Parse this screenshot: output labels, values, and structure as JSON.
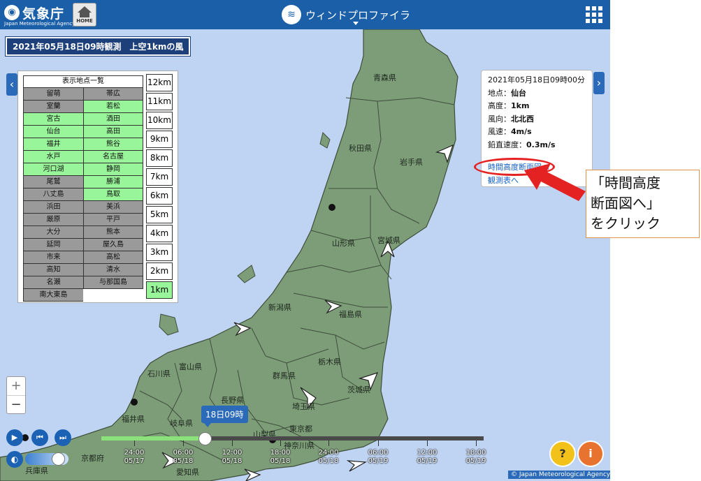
{
  "header": {
    "logo_jp": "気象庁",
    "logo_en": "Japan Meteorological Agency",
    "home_label": "HOME",
    "title": "ウィンドプロファイラ"
  },
  "observation_label": "2021年05月18日09時観測　上空1kmの風",
  "stations": {
    "heading": "表示地点一覧",
    "list": [
      {
        "name": "留萌",
        "active": false
      },
      {
        "name": "帯広",
        "active": false
      },
      {
        "name": "室蘭",
        "active": false
      },
      {
        "name": "若松",
        "active": true
      },
      {
        "name": "宮古",
        "active": true
      },
      {
        "name": "酒田",
        "active": true
      },
      {
        "name": "仙台",
        "active": true
      },
      {
        "name": "高田",
        "active": true
      },
      {
        "name": "福井",
        "active": true
      },
      {
        "name": "熊谷",
        "active": true
      },
      {
        "name": "水戸",
        "active": true
      },
      {
        "name": "名古屋",
        "active": true
      },
      {
        "name": "河口湖",
        "active": true
      },
      {
        "name": "静岡",
        "active": true
      },
      {
        "name": "尾鷲",
        "active": false
      },
      {
        "name": "勝浦",
        "active": true
      },
      {
        "name": "八丈島",
        "active": false
      },
      {
        "name": "鳥取",
        "active": true
      },
      {
        "name": "浜田",
        "active": false
      },
      {
        "name": "美浜",
        "active": false
      },
      {
        "name": "厳原",
        "active": false
      },
      {
        "name": "平戸",
        "active": false
      },
      {
        "name": "大分",
        "active": false
      },
      {
        "name": "熊本",
        "active": false
      },
      {
        "name": "延岡",
        "active": false
      },
      {
        "name": "屋久島",
        "active": false
      },
      {
        "name": "市来",
        "active": false
      },
      {
        "name": "高松",
        "active": false
      },
      {
        "name": "高知",
        "active": false
      },
      {
        "name": "清水",
        "active": false
      },
      {
        "name": "名瀬",
        "active": false
      },
      {
        "name": "与那国島",
        "active": false
      },
      {
        "name": "南大東島",
        "active": false
      }
    ]
  },
  "altitudes": [
    {
      "label": "12km",
      "active": false
    },
    {
      "label": "11km",
      "active": false
    },
    {
      "label": "10km",
      "active": false
    },
    {
      "label": "9km",
      "active": false
    },
    {
      "label": "8km",
      "active": false
    },
    {
      "label": "7km",
      "active": false
    },
    {
      "label": "6km",
      "active": false
    },
    {
      "label": "5km",
      "active": false
    },
    {
      "label": "4km",
      "active": false
    },
    {
      "label": "3km",
      "active": false
    },
    {
      "label": "2km",
      "active": false
    },
    {
      "label": "1km",
      "active": true
    }
  ],
  "info": {
    "datetime": "2021年05月18日09時00分",
    "point_label": "地点：",
    "point": "仙台",
    "altitude_label": "高度：",
    "altitude": "1km",
    "direction_label": "風向：",
    "direction": "北北西",
    "speed_label": "風速：",
    "speed": "4m/s",
    "vertical_label": "鉛直速度：",
    "vertical": "0.3m/s",
    "link_section": "時間高度断面図へ",
    "link_table": "観測表へ"
  },
  "callout": {
    "line1": "「時間高度",
    "line2": "断面図へ」",
    "line3": "をクリック"
  },
  "prefectures": {
    "aomori": "青森県",
    "akita": "秋田県",
    "iwate": "岩手県",
    "yamagata": "山形県",
    "miyagi": "宮城県",
    "niigata": "新潟県",
    "fukushima": "福島県",
    "tochigi": "栃木県",
    "gunma": "群馬県",
    "ibaraki": "茨城県",
    "saitama": "埼玉県",
    "toyama": "富山県",
    "ishikawa": "石川県",
    "nagano": "長野県",
    "fukui": "福井県",
    "gifu": "岐阜県",
    "yamanashi": "山梨県",
    "tokyo": "東京都",
    "kanagawa": "神奈川県",
    "kyoto": "京都府",
    "hyogo": "兵庫県",
    "aichi": "愛知県"
  },
  "zoom": {
    "in": "+",
    "out": "−"
  },
  "timeline": {
    "current": "18日09時",
    "progress": 0.27,
    "ticks": [
      {
        "time": "24:00",
        "date": "05/17"
      },
      {
        "time": "06:00",
        "date": "05/18"
      },
      {
        "time": "12:00",
        "date": "05/18"
      },
      {
        "time": "18:00",
        "date": "05/18"
      },
      {
        "time": "24:00",
        "date": "05/18"
      },
      {
        "time": "06:00",
        "date": "05/19"
      },
      {
        "time": "12:00",
        "date": "05/19"
      },
      {
        "time": "18:00",
        "date": "05/19"
      }
    ]
  },
  "opacity_level": 0.75,
  "copyright": "© Japan Meteorological Agency",
  "colors": {
    "header": "#1a5fa8",
    "land": "#7d9c78",
    "sea": "#bfd3f2",
    "active_station": "#99f59a",
    "inactive_station": "#9a9a9a",
    "highlight": "#e52222"
  }
}
